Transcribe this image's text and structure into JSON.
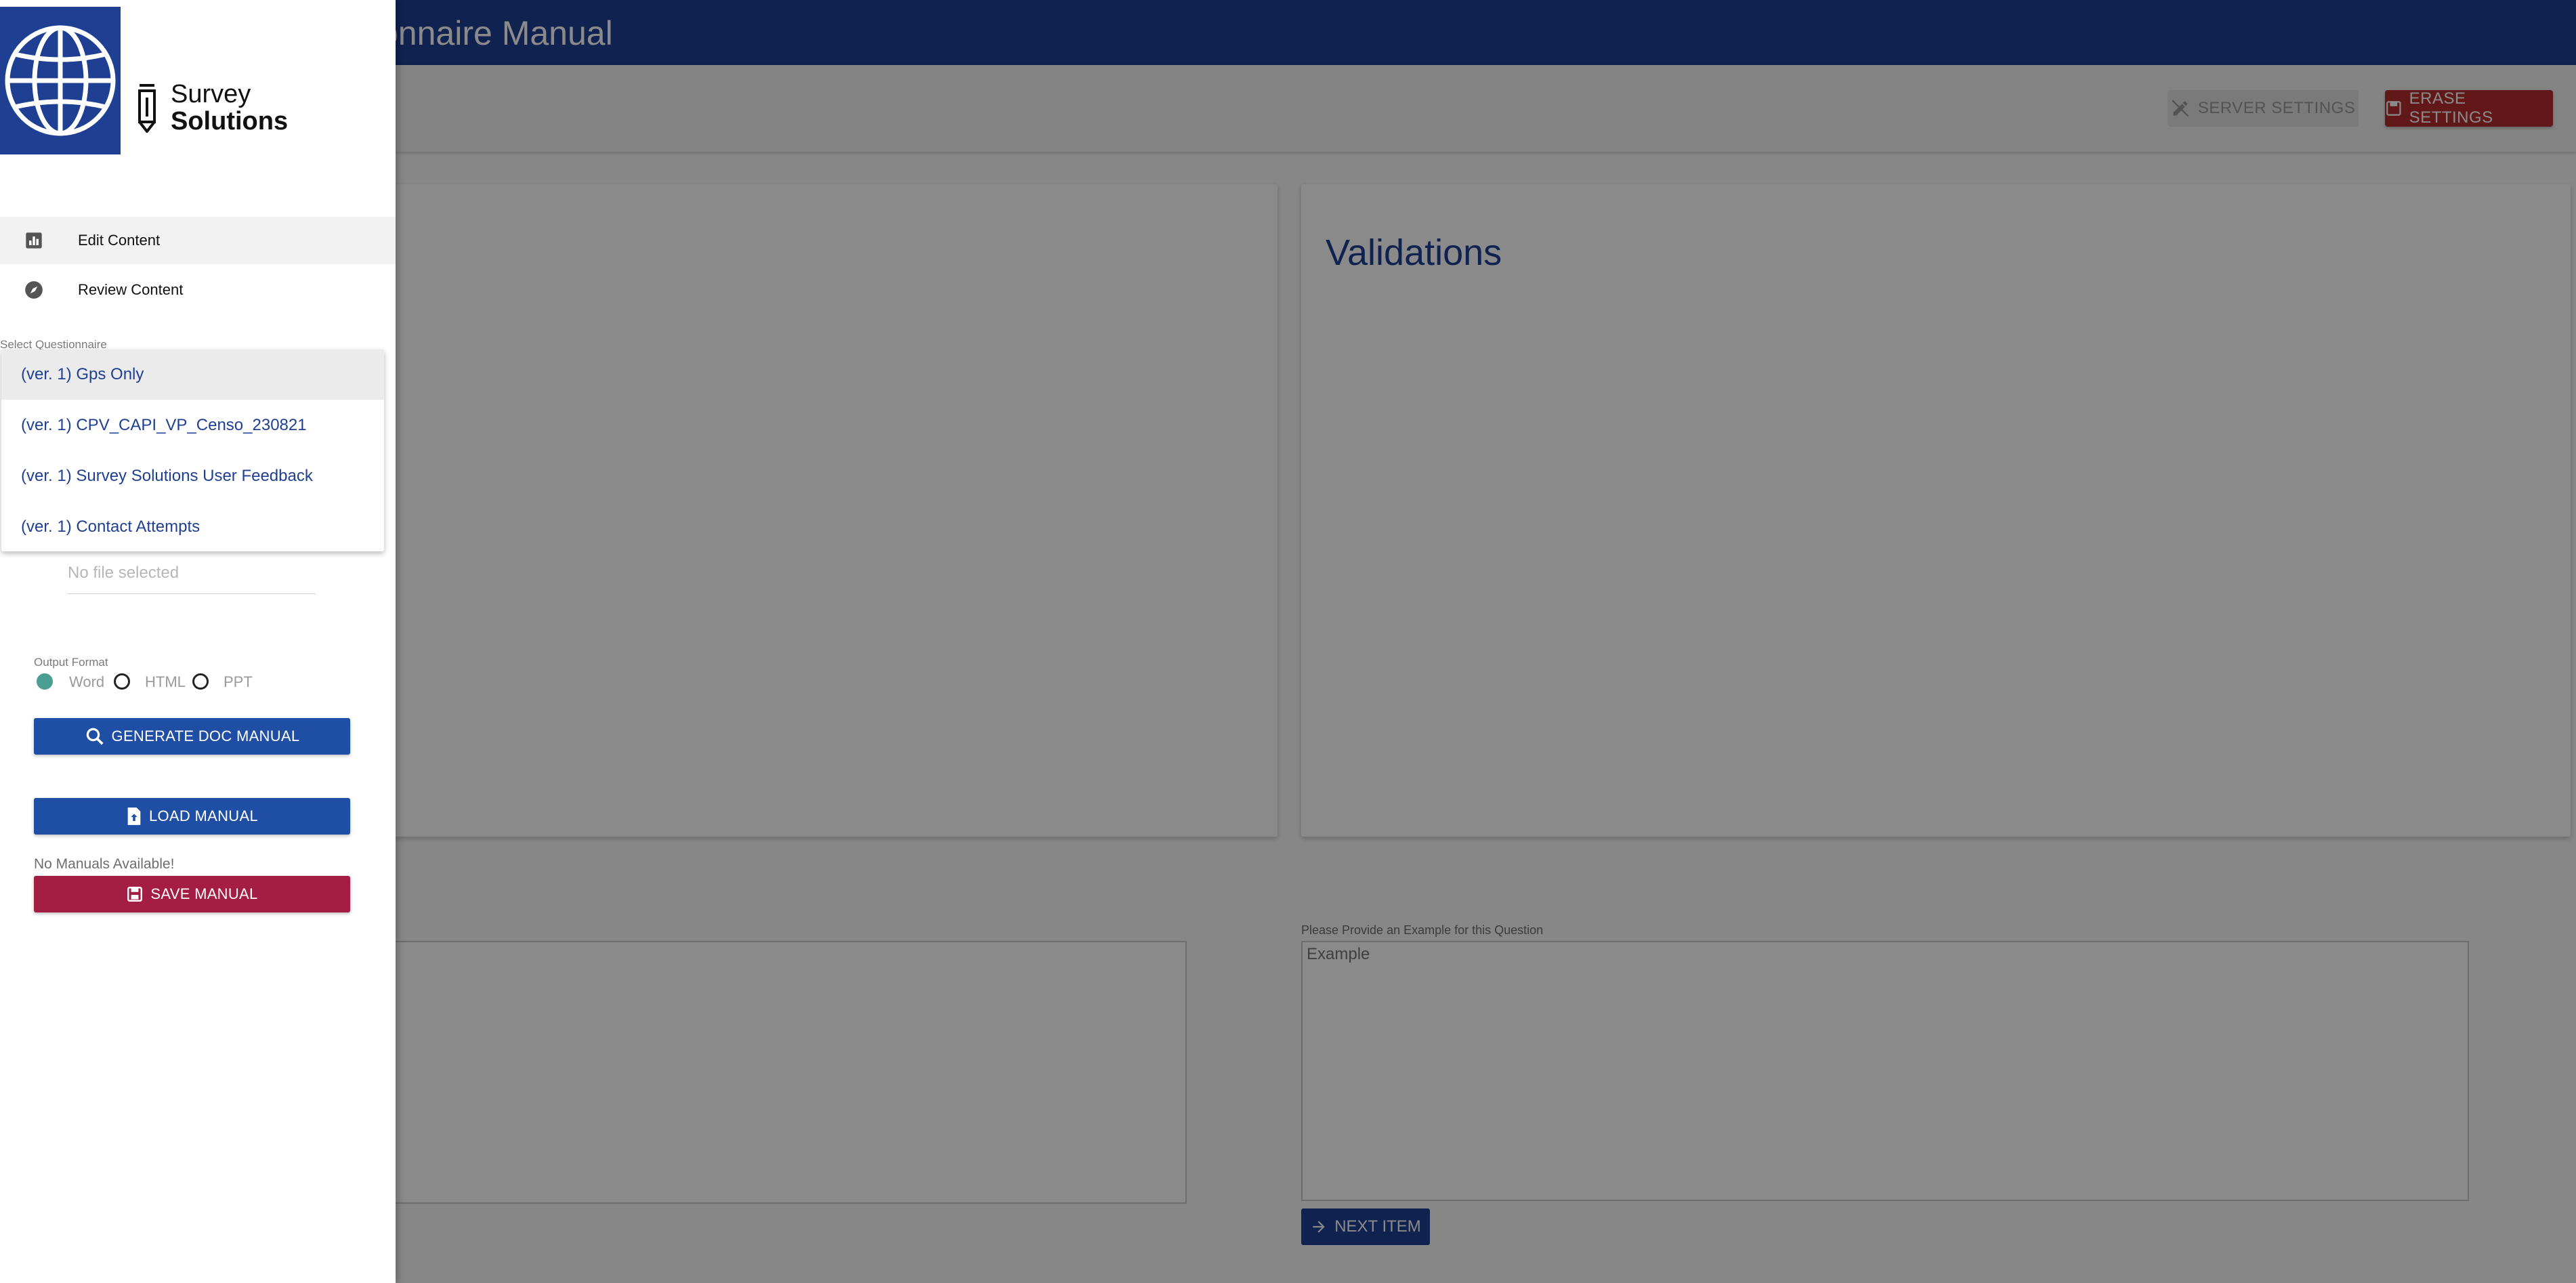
{
  "header": {
    "title": "onnaire Manual"
  },
  "toolbar": {
    "server_settings": "SERVER SETTINGS",
    "erase_settings": "ERASE SETTINGS"
  },
  "cards": {
    "validations_title": "Validations"
  },
  "example": {
    "label": "Please Provide an Example for this Question",
    "placeholder": "Example"
  },
  "next_button": "NEXT ITEM",
  "drawer": {
    "brand": {
      "line1": "Survey",
      "line2": "Solutions"
    },
    "nav": [
      {
        "label": "Edit Content",
        "icon": "bar-chart-icon"
      },
      {
        "label": "Review Content",
        "icon": "compass-icon"
      }
    ],
    "select_label": "Select Questionnaire",
    "questionnaires": [
      "(ver. 1) Gps Only",
      "(ver. 1) CPV_CAPI_VP_Censo_230821",
      "(ver. 1) Survey Solutions User Feedback",
      "(ver. 1) Contact Attempts"
    ],
    "file_placeholder": "No file selected",
    "output_format_label": "Output Format",
    "output_formats": [
      "Word",
      "HTML",
      "PPT"
    ],
    "selected_format": "Word",
    "generate_button": "GENERATE DOC MANUAL",
    "load_button": "LOAD MANUAL",
    "no_manuals": "No Manuals Available!",
    "save_button": "SAVE MANUAL"
  },
  "colors": {
    "primary": "#1f3f93",
    "danger": "#b52d2d",
    "save": "#a31d45",
    "radio_on": "#4a9e92"
  }
}
